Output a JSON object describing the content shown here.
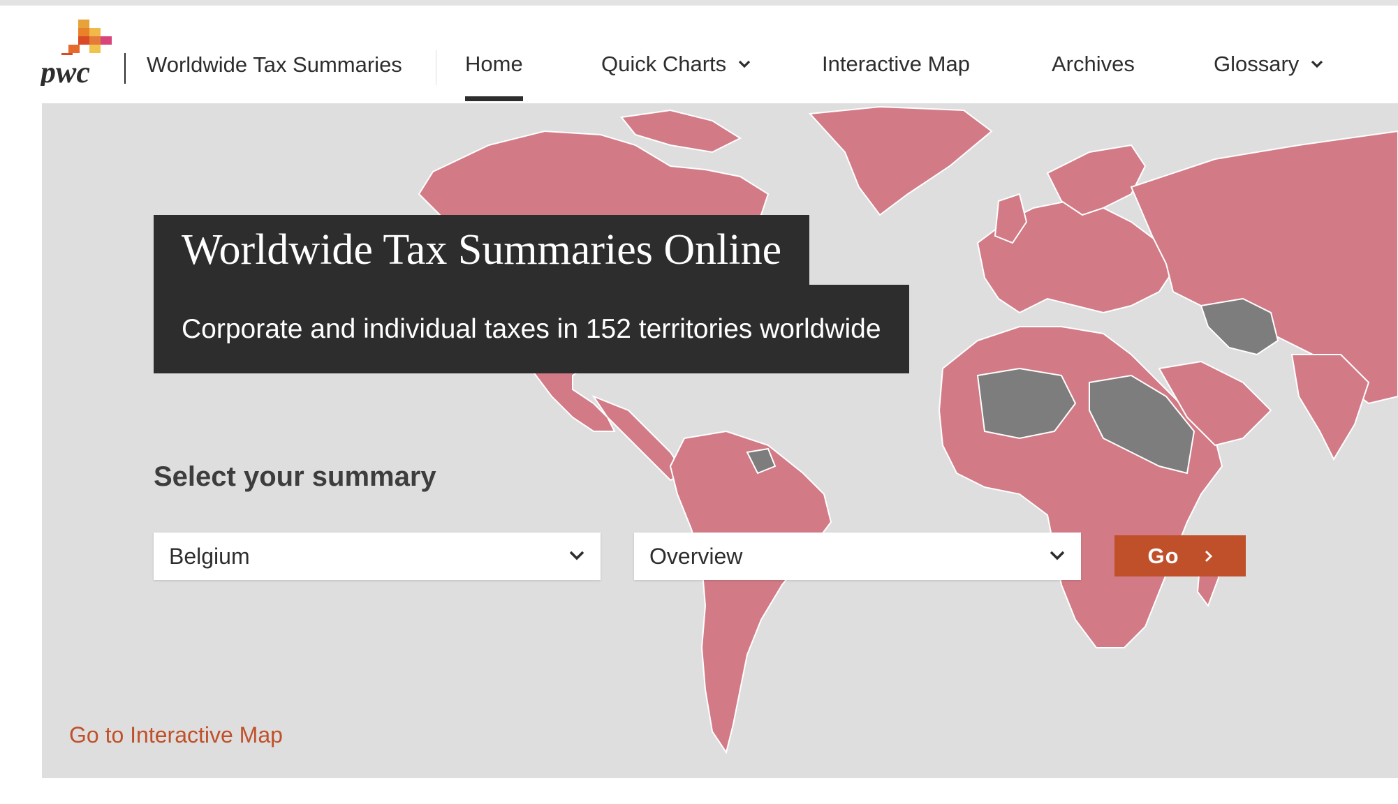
{
  "header": {
    "logo_text": "pwc",
    "site_title": "Worldwide Tax Summaries",
    "nav": [
      {
        "label": "Home",
        "active": true
      },
      {
        "label": "Quick Charts",
        "has_dropdown": true
      },
      {
        "label": "Interactive Map"
      },
      {
        "label": "Archives"
      },
      {
        "label": "Glossary",
        "has_dropdown": true
      }
    ],
    "icons": {
      "dropdown": "chevron-down-icon"
    }
  },
  "hero": {
    "title": "Worldwide Tax Summaries Online",
    "subtitle": "Corporate and individual taxes in 152 territories worldwide",
    "select_heading": "Select your summary",
    "country_select": {
      "value": "Belgium"
    },
    "topic_select": {
      "value": "Overview"
    },
    "go_button": {
      "label": "Go",
      "icon": "chevron-right-icon"
    },
    "map_link": "Go to Interactive Map"
  },
  "colors": {
    "brand_orange": "#c0502a",
    "dark_box": "#2d2d2d",
    "map_covered": "#d27b87",
    "map_not_covered": "#7d7d7d",
    "map_background": "#dedede"
  }
}
